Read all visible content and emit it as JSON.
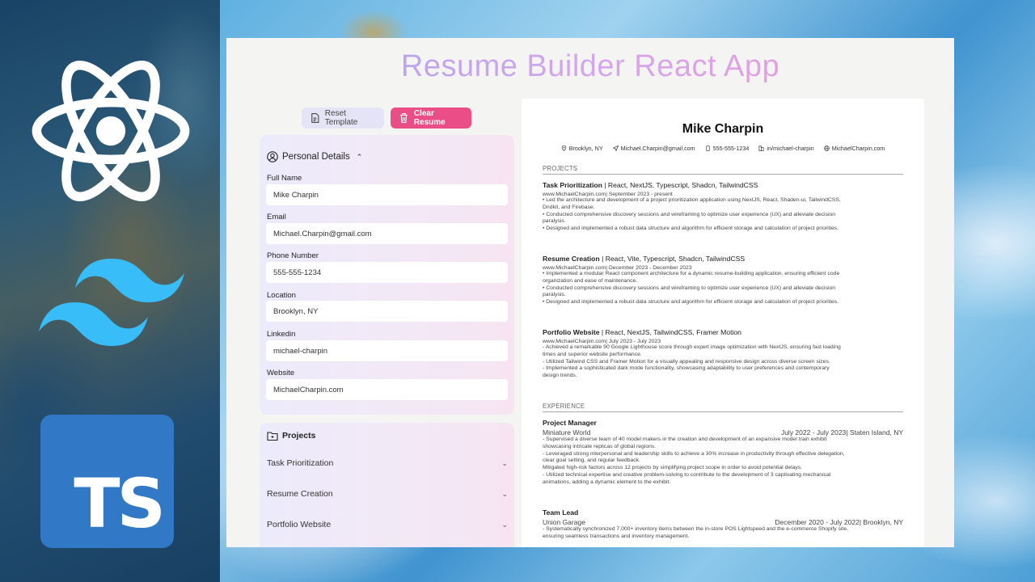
{
  "app": {
    "title": "Resume Builder React App"
  },
  "buttons": {
    "reset": "Reset Template",
    "clear": "Clear Resume"
  },
  "personal": {
    "header": "Personal Details",
    "fields": [
      {
        "label": "Full Name",
        "value": "Mike Charpin"
      },
      {
        "label": "Email",
        "value": "Michael.Charpin@gmail.com"
      },
      {
        "label": "Phone Number",
        "value": "555-555-1234"
      },
      {
        "label": "Location",
        "value": "Brooklyn, NY"
      },
      {
        "label": "Linkedin",
        "value": "michael-charpin"
      },
      {
        "label": "Website",
        "value": "MichaelCharpin.com"
      }
    ]
  },
  "projects_panel": {
    "header": "Projects",
    "items": [
      "Task Prioritization",
      "Resume Creation",
      "Portfolio Website"
    ]
  },
  "resume": {
    "name": "Mike Charpin",
    "contact": {
      "location": "Brooklyn, NY",
      "email": "Michael.Charpin@gmail.com",
      "phone": "555-555-1234",
      "linkedin": "in/michael-charpin",
      "website": "MichaelCharpin.com"
    },
    "projects_heading": "PROJECTS",
    "projects": [
      {
        "name": "Task Prioritization",
        "stack": " | React, NextJS, Typescript, Shadcn, TailwindCSS",
        "meta": "www.MichaelCharpin.com| September 2023 - present",
        "bullets": [
          "• Led the architecture and development of a project prioritization application using NextJS, React, Shaden-ui, TailwindCSS,",
          "Dndkit, and Firebase.",
          "• Conducted comprehensive discovery sessions and wireframing to optimize user experience (UX) and alleviate decision",
          "paralysis.",
          "• Designed and implemented a robust data structure and algorithm for efficient storage and calculation of project priorities."
        ]
      },
      {
        "name": "Resume Creation",
        "stack": " | React, Vite, Typescript, Shadcn, TailwindCSS",
        "meta": "www.MichaelCharpin.com| December 2023 - December 2023",
        "bullets": [
          "• Implemented a modular React component architecture for a dynamic resume-building application, ensuring efficient code",
          "organization and ease of maintenance.",
          "• Conducted comprehensive discovery sessions and wireframing to optimize user experience (UX) and alleviate decision",
          "paralysis.",
          "• Designed and implemented a robust data structure and algorithm for efficient storage and calculation of project priorities."
        ]
      },
      {
        "name": "Portfolio Website",
        "stack": " | React, NextJS, TailwindCSS, Framer Motion",
        "meta": "www.MichaelCharpin.com| July 2023 - July 2023",
        "bullets": [
          "- Achieved a remarkable 90 Google Lighthouse score through expert image optimization with NextJS, ensuring fast loading",
          "times and superior website performance.",
          "- Utilized Tailwind CSS and Framer Motion for a visually appealing and responsive design across diverse screen sizes.",
          "- Implemented a sophisticated dark mode functionality, showcasing adaptability to user preferences and contemporary",
          "design trends."
        ]
      }
    ],
    "experience_heading": "EXPERIENCE",
    "experience": [
      {
        "title": "Project Manager",
        "company": "Miniature World",
        "dates": "July 2022 - July 2023| Staten Island, NY",
        "bullets": [
          "- Supervised a diverse team of 40 model makers in the creation and development of an expansive model train exhibit",
          "showcasing intricate replicas of global regions.",
          " - Leveraged strong interpersonal and leadership skills to achieve a 30% increase in productivity through effective delegation,",
          "clear goal setting, and regular feedback.",
          " Mitigated high-risk factors across 12 projects by simplifying project scope in order to avoid potential delays.",
          " -  Utilized technical expertise and creative problem-solving to contribute to the development of 3 captivating mechanical",
          "animations, adding a dynamic element to the exhibit."
        ]
      },
      {
        "title": "Team Lead",
        "company": "Union Garage",
        "dates": "December 2020 - July 2022| Brooklyn, NY",
        "bullets": [
          "- Systematically synchronized 7,000+ inventory items between the in-store POS Lightspeed and the e-commerce Shopify site,",
          "ensuring seamless transactions and inventory management."
        ]
      }
    ]
  },
  "colors": {
    "accent_pink": "#ea4e86",
    "react_logo": "#ffffff",
    "tailwind_logo": "#38bdf8",
    "typescript_logo": "#3178c6"
  }
}
